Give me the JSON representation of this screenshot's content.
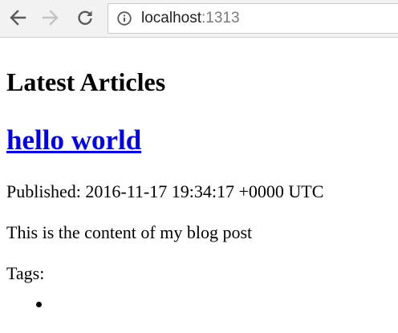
{
  "browser": {
    "url_host": "localhost",
    "url_port": ":1313"
  },
  "page": {
    "heading": "Latest Articles",
    "article": {
      "title": "hello world",
      "published": "Published: 2016-11-17 19:34:17 +0000 UTC",
      "body": "This is the content of my blog post",
      "tags_label": "Tags:",
      "tags": [
        ""
      ]
    }
  },
  "colors": {
    "link": "#0000ee",
    "toolbar": "#f2f2f2"
  }
}
